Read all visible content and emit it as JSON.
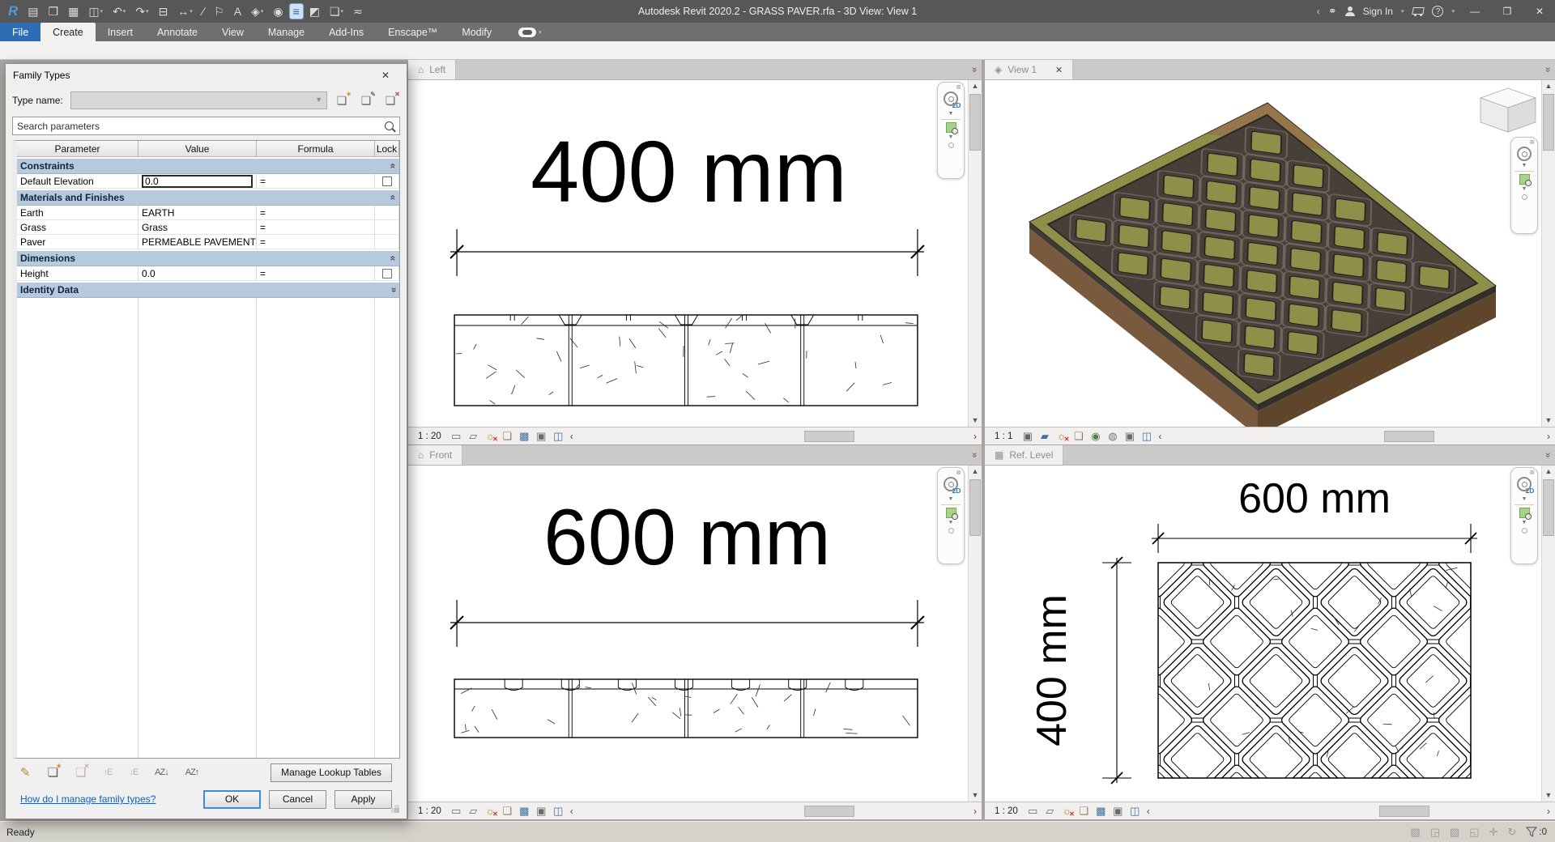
{
  "window": {
    "title": "Autodesk Revit 2020.2 - GRASS PAVER.rfa - 3D View: View 1",
    "sign_in": "Sign In",
    "ready": "Ready",
    "filter_count": ":0"
  },
  "quick_access": [
    {
      "name": "revit-logo",
      "glyph": "R",
      "logo": true
    },
    {
      "name": "file-document-icon",
      "glyph": "▤"
    },
    {
      "name": "open-icon",
      "glyph": "❒"
    },
    {
      "name": "save-icon",
      "glyph": "▦"
    },
    {
      "name": "export-icon",
      "glyph": "◫",
      "dropdown": true
    },
    {
      "name": "undo-icon",
      "glyph": "↶",
      "dropdown": true
    },
    {
      "name": "redo-icon",
      "glyph": "↷",
      "dropdown": true
    },
    {
      "name": "print-icon",
      "glyph": "⊟"
    },
    {
      "name": "measure-icon",
      "glyph": "↔",
      "dropdown": true
    },
    {
      "name": "aligned-dimension-icon",
      "glyph": "∕"
    },
    {
      "name": "tag-icon",
      "glyph": "⚐"
    },
    {
      "name": "text-icon",
      "glyph": "A"
    },
    {
      "name": "default-3d-view-icon",
      "glyph": "◈",
      "dropdown": true
    },
    {
      "name": "section-icon",
      "glyph": "◉"
    },
    {
      "name": "thin-lines-icon",
      "glyph": "≡",
      "active": true
    },
    {
      "name": "user-interface-icon",
      "glyph": "◩"
    },
    {
      "name": "switch-windows-icon",
      "glyph": "❏",
      "dropdown": true
    },
    {
      "name": "customize-qat-icon",
      "glyph": "≂"
    }
  ],
  "ribbon": {
    "tabs": [
      "File",
      "Create",
      "Insert",
      "Annotate",
      "View",
      "Manage",
      "Add-Ins",
      "Enscape™",
      "Modify"
    ],
    "active": "Create"
  },
  "dialog": {
    "title": "Family Types",
    "type_name_label": "Type name:",
    "type_name_value": "",
    "search_placeholder": "Search parameters",
    "columns": [
      "Parameter",
      "Value",
      "Formula",
      "Lock"
    ],
    "groups": [
      {
        "name": "Constraints",
        "collapsed": false,
        "rows": [
          {
            "parameter": "Default Elevation",
            "value": "0.0",
            "formula": "=",
            "lock": true,
            "editing": true
          }
        ]
      },
      {
        "name": "Materials and Finishes",
        "collapsed": false,
        "rows": [
          {
            "parameter": "Earth",
            "value": "EARTH",
            "formula": "="
          },
          {
            "parameter": "Grass",
            "value": "Grass",
            "formula": "="
          },
          {
            "parameter": "Paver",
            "value": "PERMEABLE PAVEMENT",
            "formula": "="
          }
        ]
      },
      {
        "name": "Dimensions",
        "collapsed": false,
        "rows": [
          {
            "parameter": "Height",
            "value": "0.0",
            "formula": "=",
            "lock": true
          }
        ]
      },
      {
        "name": "Identity Data",
        "collapsed": true,
        "rows": []
      }
    ],
    "toolbar_icons": [
      {
        "name": "edit-parameter-icon",
        "glyph": "✎",
        "cls": "gold"
      },
      {
        "name": "new-parameter-icon",
        "glyph": "❏",
        "badge": "✶",
        "badge_color": "#d98e2b"
      },
      {
        "name": "delete-parameter-icon",
        "glyph": "❏",
        "badge": "✕",
        "badge_color": "#d0a0a0",
        "cls": "dis"
      },
      {
        "name": "move-up-icon",
        "glyph": "↑E",
        "az": true,
        "cls": "dis"
      },
      {
        "name": "move-down-icon",
        "glyph": "↓E",
        "az": true,
        "cls": "dis"
      },
      {
        "name": "sort-ascending-icon",
        "glyph": "AZ↓",
        "az": true
      },
      {
        "name": "sort-descending-icon",
        "glyph": "AZ↑",
        "az": true
      }
    ],
    "manage_lookup_label": "Manage Lookup Tables",
    "help_link": "How do I manage family types?",
    "ok": "OK",
    "cancel": "Cancel",
    "apply": "Apply"
  },
  "viewports": {
    "top_left": {
      "tab": "Left",
      "scale": "1 : 20",
      "dim": "400 mm"
    },
    "top_right": {
      "tab": "View 1",
      "scale": "1 : 1"
    },
    "bottom_left": {
      "tab": "Front",
      "scale": "1 : 20",
      "dim": "600 mm"
    },
    "bottom_right": {
      "tab": "Ref. Level",
      "scale": "1 : 20",
      "dim_top": "600 mm",
      "dim_left": "400 mm"
    }
  },
  "nav_bar": {
    "wheel_label": "2D"
  },
  "control_icons": {
    "d2": [
      {
        "name": "detail-level-icon",
        "glyph": "▭",
        "color": "#666"
      },
      {
        "name": "visual-style-icon",
        "glyph": "▱",
        "color": "#666"
      },
      {
        "name": "sun-path-icon",
        "glyph": "☼",
        "color": "#b0861f",
        "badge": "✕",
        "badge_color": "#cc2a2a"
      },
      {
        "name": "shadows-icon",
        "glyph": "❏",
        "color": "#8c7a57"
      },
      {
        "name": "crop-view-icon",
        "glyph": "▩",
        "color": "#44709d"
      },
      {
        "name": "crop-region-icon",
        "glyph": "▣",
        "color": "#6b6b6b"
      },
      {
        "name": "reveal-hidden-icon",
        "glyph": "◫",
        "color": "#44709d"
      }
    ],
    "d3": [
      {
        "name": "detail-level-icon",
        "glyph": "▣",
        "color": "#666"
      },
      {
        "name": "visual-style-icon",
        "glyph": "▰",
        "color": "#44709d"
      },
      {
        "name": "sun-path-icon",
        "glyph": "☼",
        "color": "#b0861f",
        "badge": "✕",
        "badge_color": "#cc2a2a"
      },
      {
        "name": "shadows-icon",
        "glyph": "❏",
        "color": "#8c7a57"
      },
      {
        "name": "locked-3d-view-icon",
        "glyph": "◉",
        "color": "#4f7d46"
      },
      {
        "name": "render-icon",
        "glyph": "◍",
        "color": "#777"
      },
      {
        "name": "crop-region-icon",
        "glyph": "▣",
        "color": "#6b6b6b"
      },
      {
        "name": "reveal-hidden-icon",
        "glyph": "◫",
        "color": "#44709d"
      }
    ]
  },
  "status_icons": [
    {
      "name": "worksets-icon",
      "glyph": "▧"
    },
    {
      "name": "design-options-icon",
      "glyph": "◲"
    },
    {
      "name": "editable-only-icon",
      "glyph": "▨"
    },
    {
      "name": "exclude-options-icon",
      "glyph": "◱"
    },
    {
      "name": "press-drag-icon",
      "glyph": "✛"
    },
    {
      "name": "background-processes-icon",
      "glyph": "↻"
    }
  ]
}
